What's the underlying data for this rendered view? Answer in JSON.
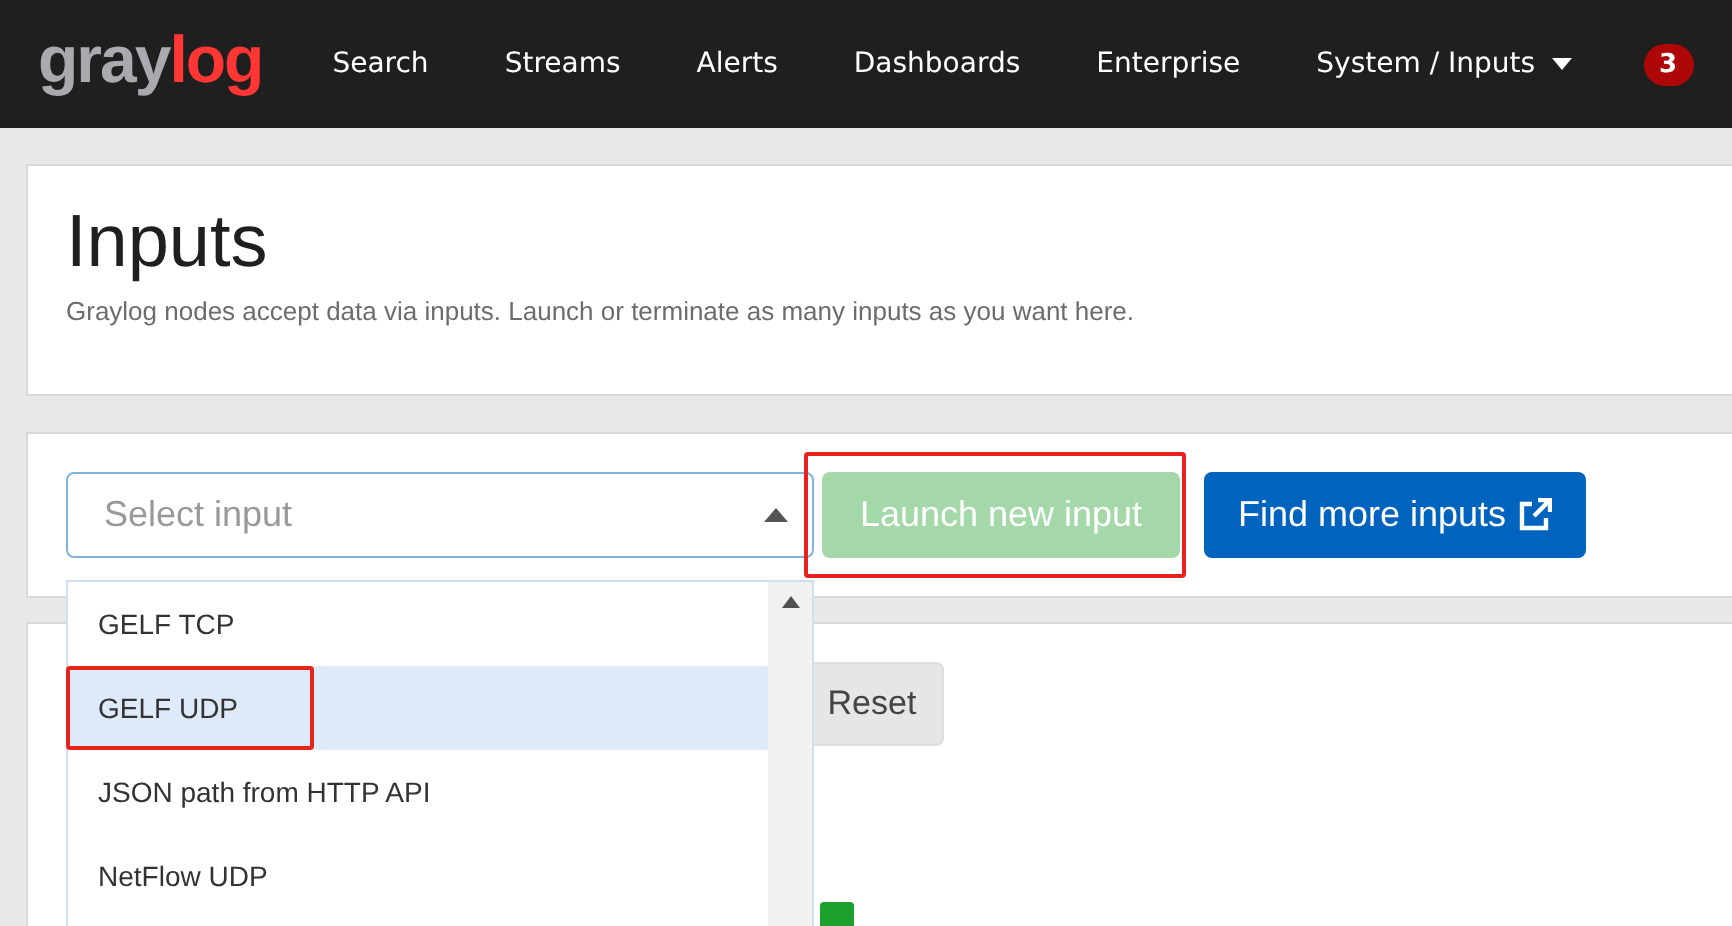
{
  "navbar": {
    "brand": [
      "gray",
      "log"
    ],
    "items": [
      {
        "label": "Search",
        "dropdown": false
      },
      {
        "label": "Streams",
        "dropdown": false
      },
      {
        "label": "Alerts",
        "dropdown": false
      },
      {
        "label": "Dashboards",
        "dropdown": false
      },
      {
        "label": "Enterprise",
        "dropdown": false
      },
      {
        "label": "System / Inputs",
        "dropdown": true
      }
    ],
    "notification_count": "3"
  },
  "header": {
    "title": "Inputs",
    "description": "Graylog nodes accept data via inputs. Launch or terminate as many inputs as you want here."
  },
  "launcher": {
    "select": {
      "placeholder": "Select input",
      "expanded": true
    },
    "launch_button": {
      "label": "Launch new input",
      "disabled": true,
      "highlighted": true
    },
    "find_button": {
      "label": "Find more inputs",
      "external": true
    },
    "options": [
      {
        "label": "GELF TCP",
        "selected": false,
        "highlighted": false
      },
      {
        "label": "GELF UDP",
        "selected": true,
        "highlighted": true
      },
      {
        "label": "JSON path from HTTP API",
        "selected": false,
        "highlighted": false
      },
      {
        "label": "NetFlow UDP",
        "selected": false,
        "highlighted": false
      }
    ]
  },
  "filter": {
    "reset_button": "Reset"
  }
}
